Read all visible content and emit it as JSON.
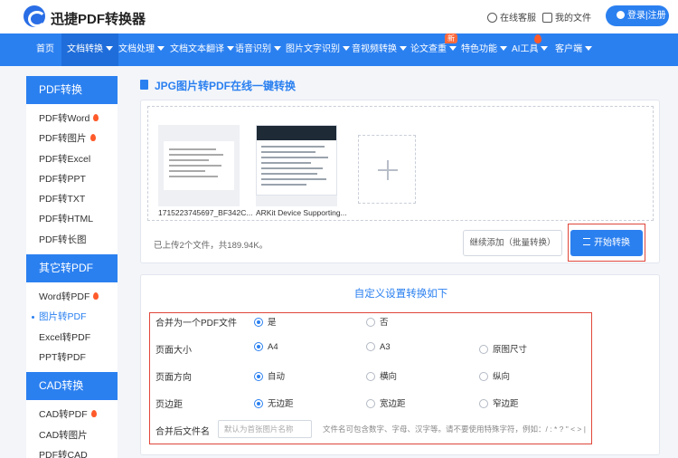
{
  "header": {
    "brand": "迅捷PDF转换器",
    "service": "在线客服",
    "my_docs": "我的文件",
    "login": "登录|注册"
  },
  "nav": {
    "items": [
      "首页",
      "文档转换",
      "文档处理",
      "文档文本翻译",
      "语音识别",
      "图片文字识别",
      "音视频转换",
      "论文查重",
      "特色功能",
      "AI工具",
      "客户端"
    ],
    "new_badge": "新"
  },
  "sidebar": {
    "sections": [
      {
        "title": "PDF转换",
        "items": [
          "PDF转Word",
          "PDF转图片",
          "PDF转Excel",
          "PDF转PPT",
          "PDF转TXT",
          "PDF转HTML",
          "PDF转长图"
        ]
      },
      {
        "title": "其它转PDF",
        "items": [
          "Word转PDF",
          "图片转PDF",
          "Excel转PDF",
          "PPT转PDF"
        ]
      },
      {
        "title": "CAD转换",
        "items": [
          "CAD转PDF",
          "CAD转图片",
          "PDF转CAD"
        ]
      }
    ]
  },
  "main": {
    "title": "JPG图片转PDF在线一键转换",
    "files": [
      "1715223745697_BF342C...",
      "ARKit Device Supporting..."
    ],
    "upload_info": "已上传2个文件，共189.94K。",
    "continue_button": "继续添加（批量转换）",
    "start_button": "开始转换"
  },
  "settings": {
    "title": "自定义设置转换如下",
    "merge": {
      "label": "合并为一个PDF文件",
      "options": [
        "是",
        "否"
      ],
      "selected": "是"
    },
    "page_size": {
      "label": "页面大小",
      "options": [
        "A4",
        "A3",
        "原图尺寸"
      ],
      "selected": "A4"
    },
    "orientation": {
      "label": "页面方向",
      "options": [
        "自动",
        "横向",
        "纵向"
      ],
      "selected": "自动"
    },
    "margin": {
      "label": "页边距",
      "options": [
        "无边距",
        "宽边距",
        "窄边距"
      ],
      "selected": "无边距"
    },
    "filename": {
      "label": "合并后文件名",
      "placeholder": "默认为首张图片名称",
      "hint": "文件名可包含数字、字母、汉字等。请不要使用特殊字符，例如：/ : * ? \" < > |"
    }
  },
  "colors": {
    "accent": "#2b80f0",
    "highlight": "#e0463a",
    "fire": "#ff5a2a"
  }
}
